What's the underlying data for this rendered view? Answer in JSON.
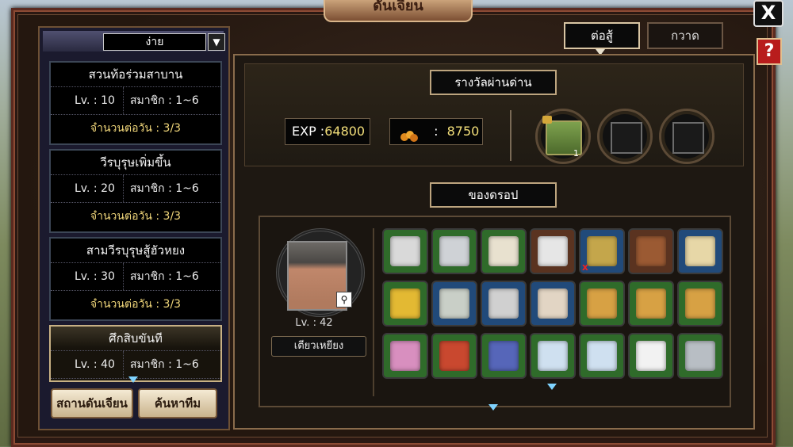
{
  "window": {
    "title": "ดันเจียน",
    "close_label": "X",
    "help_label": "?"
  },
  "difficulty": {
    "selected": "ง่าย",
    "arrow": "▼"
  },
  "dungeons": [
    {
      "name": "สวนท้อร่วมสาบาน",
      "level": "Lv. : 10",
      "members": "สมาชิก : 1~6",
      "daily": "จำนวนต่อวัน : 3/3"
    },
    {
      "name": "วีรบุรุษเพิ่มขึ้น",
      "level": "Lv. : 20",
      "members": "สมาชิก : 1~6",
      "daily": "จำนวนต่อวัน : 3/3"
    },
    {
      "name": "สามวีรบุรุษสู้ฮัวหยง",
      "level": "Lv. : 30",
      "members": "สมาชิก : 1~6",
      "daily": "จำนวนต่อวัน : 3/3"
    },
    {
      "name": "ศึกสิบขันที",
      "level": "Lv. : 40",
      "members": "สมาชิก : 1~6",
      "daily": ""
    }
  ],
  "left_buttons": {
    "station": "สถานดันเจียน",
    "find_team": "ค้นหาทีม"
  },
  "tabs": {
    "fight": "ต่อสู้",
    "sweep": "กวาด"
  },
  "reward": {
    "section_title": "รางวัลผ่านด่าน",
    "exp_label": "EXP :",
    "exp_value": "64800",
    "coin_label": ":",
    "coin_value": "8750",
    "slot1_count": "1",
    "coin_icon": "coin-icon",
    "chest_icon": "treasure-chest-icon"
  },
  "drops": {
    "section_title": "ของดรอป",
    "hero_level": "Lv. : 42",
    "hero_name": "เตียวเหยียง",
    "items": [
      {
        "icon": "silver-ore-icon",
        "bg": "#2f6b2a",
        "color": "#d9d9d9"
      },
      {
        "icon": "iron-ingot-icon",
        "bg": "#2f6b2a",
        "color": "#cfd2d6"
      },
      {
        "icon": "scroll-icon",
        "bg": "#2f6b2a",
        "color": "#e8e1cf"
      },
      {
        "icon": "feather-fan-icon",
        "bg": "#5a3320",
        "color": "#e6e6e6"
      },
      {
        "icon": "armor-icon",
        "bg": "#214a7a",
        "color": "#c4a64b",
        "x": true
      },
      {
        "icon": "staff-icon",
        "bg": "#5a3320",
        "color": "#9b5a33"
      },
      {
        "icon": "robe-icon",
        "bg": "#214a7a",
        "color": "#e7d7a7"
      },
      {
        "icon": "lucky-bag-icon",
        "bg": "#2f6b2a",
        "color": "#e3b933"
      },
      {
        "icon": "shield-icon",
        "bg": "#214a7a",
        "color": "#c9cfc7"
      },
      {
        "icon": "bracer-icon",
        "bg": "#214a7a",
        "color": "#d0d0d0"
      },
      {
        "icon": "scarf-icon",
        "bg": "#214a7a",
        "color": "#e2d5c4"
      },
      {
        "icon": "skill-book-icon",
        "bg": "#2f6b2a",
        "color": "#d7a144"
      },
      {
        "icon": "skill-book-icon",
        "bg": "#2f6b2a",
        "color": "#d7a144"
      },
      {
        "icon": "skill-book-icon",
        "bg": "#2f6b2a",
        "color": "#d7a144"
      },
      {
        "icon": "pink-book-icon",
        "bg": "#2f6b2a",
        "color": "#d88fbf"
      },
      {
        "icon": "red-book-icon",
        "bg": "#2f6b2a",
        "color": "#c9482f"
      },
      {
        "icon": "blue-book-icon",
        "bg": "#2f6b2a",
        "color": "#5666b9"
      },
      {
        "icon": "blueprint-scroll-icon",
        "bg": "#2f6b2a",
        "color": "#cfe0f0"
      },
      {
        "icon": "blueprint-scroll-icon",
        "bg": "#2f6b2a",
        "color": "#cfe0f0"
      },
      {
        "icon": "white-cloth-icon",
        "bg": "#2f6b2a",
        "color": "#f2f2f2"
      },
      {
        "icon": "dark-cloth-icon",
        "bg": "#2f6b2a",
        "color": "#b8bec4"
      }
    ]
  },
  "colors": {
    "accent_gold": "#f3df7a",
    "frame_red": "#5b2a1f",
    "help_red": "#b81c1c"
  }
}
